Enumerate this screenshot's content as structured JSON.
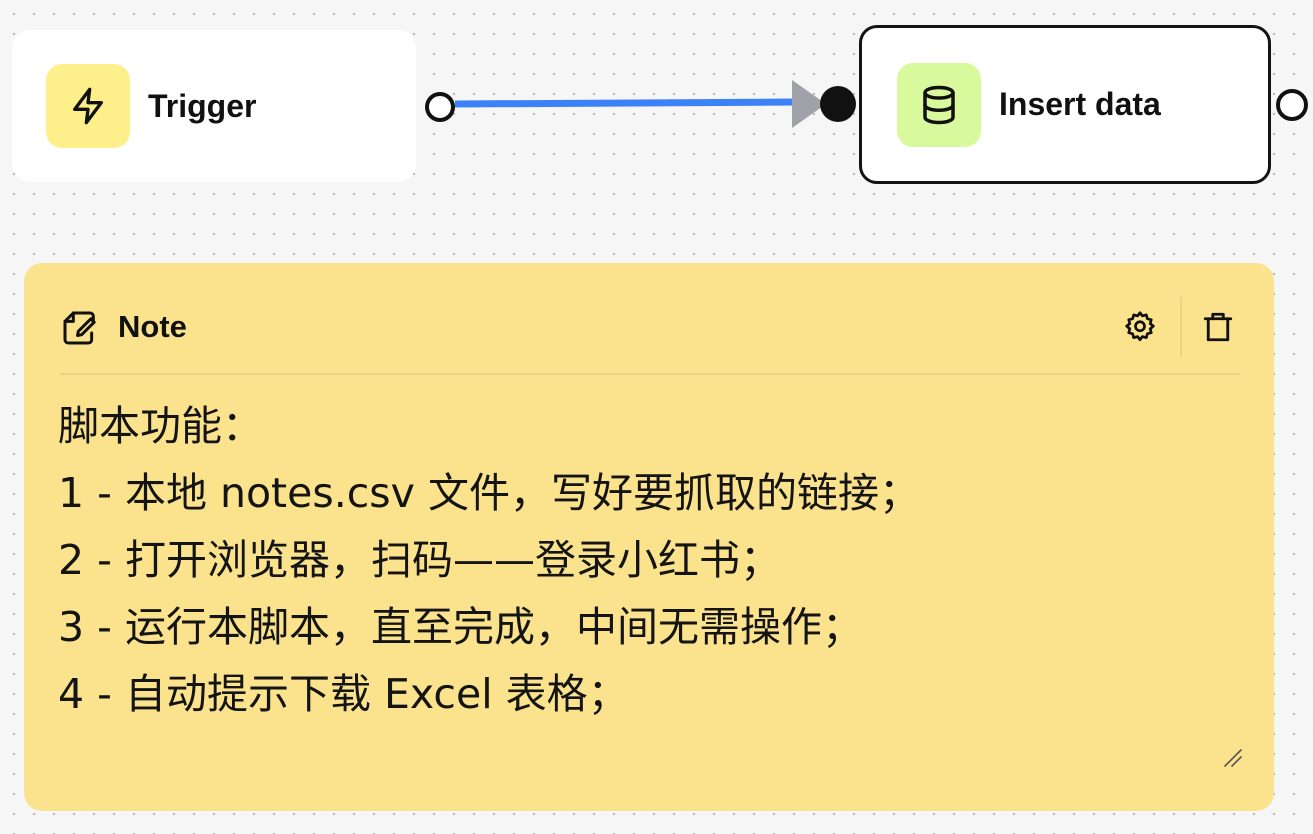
{
  "nodes": {
    "trigger": {
      "label": "Trigger",
      "icon": "lightning-bolt-icon",
      "icon_bg": "#fdf08a"
    },
    "insert_data": {
      "label": "Insert data",
      "icon": "database-icon",
      "icon_bg": "#d9f99d"
    }
  },
  "edge": {
    "color": "#3b82f6",
    "arrow_color": "#a1a1aa"
  },
  "note": {
    "title": "Note",
    "title_icon": "note-edit-icon",
    "settings_icon": "gear-icon",
    "delete_icon": "trash-icon",
    "background": "#fbe38e",
    "lines": [
      "脚本功能：",
      "1 - 本地 notes.csv 文件，写好要抓取的链接；",
      "2 - 打开浏览器，扫码——登录小红书；",
      "3 - 运行本脚本，直至完成，中间无需操作；",
      "4 - 自动提示下载 Excel 表格；"
    ]
  }
}
